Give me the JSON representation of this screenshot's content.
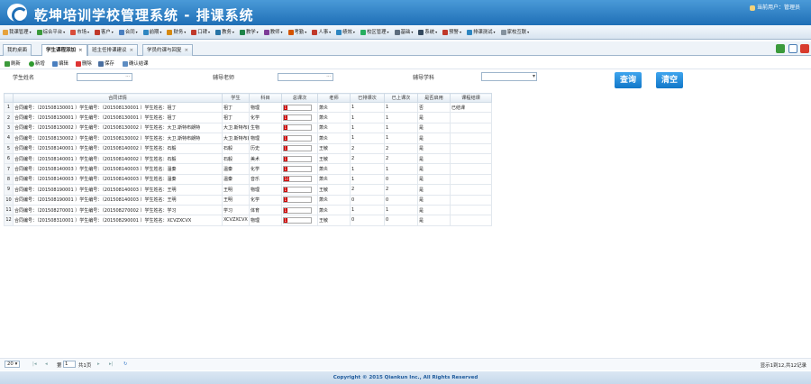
{
  "app": {
    "title": "乾坤培训学校管理系统 - 排课系统",
    "user": "当前用户：管理员"
  },
  "menu": [
    "我课管理",
    "综合平台",
    "市场",
    "客户",
    "合同",
    "前期",
    "财务",
    "口碑",
    "教务",
    "教学",
    "教师",
    "考勤",
    "人事",
    "绩效",
    "校区管理",
    "基础",
    "系统",
    "预警",
    "排课测试",
    "家校互联"
  ],
  "tabs": [
    "我的桌面",
    "学生课程添加",
    "班主任排课建议",
    "学员约课与回复"
  ],
  "toolbar": {
    "refresh": "刷新",
    "add": "新增",
    "edit": "编辑",
    "del": "删除",
    "save": "保存",
    "confirm": "确认结课"
  },
  "filters": {
    "student": "学生姓名",
    "teacher": "辅导老师",
    "subject": "辅导学科",
    "query": "查询",
    "clear": "清空",
    "dots": "···"
  },
  "table": {
    "headers": [
      "合同详情",
      "学生",
      "科目",
      "总课次",
      "老师",
      "已排课次",
      "已上课次",
      "是否启用",
      "课程结课"
    ],
    "rows": [
      [
        "1",
        "合同编号：（201508130001 ）学生编号：（201508130001 ）学生姓名：祖丁",
        "祖丁",
        "物理",
        "1",
        "萧炎",
        "1",
        "1",
        "否",
        "已结课"
      ],
      [
        "2",
        "合同编号：（201508130001 ）学生编号：（201508130001 ）学生姓名：祖丁",
        "祖丁",
        "化学",
        "1",
        "萧炎",
        "1",
        "1",
        "是",
        ""
      ],
      [
        "3",
        "合同编号：（201508130002 ）学生编号：（201508130002 ）学生姓名：大卫.斯特布朗特",
        "大卫.斯特布朗特",
        "生物",
        "1",
        "萧炎",
        "1",
        "1",
        "是",
        ""
      ],
      [
        "4",
        "合同编号：（201508130002 ）学生编号：（201508130002 ）学生姓名：大卫.斯特布朗特",
        "大卫.斯特布朗特",
        "物理",
        "1",
        "萧炎",
        "1",
        "1",
        "是",
        ""
      ],
      [
        "5",
        "合同编号：（201508140001 ）学生编号：（201508140002 ）学生姓名：石毅",
        "石毅",
        "历史",
        "1",
        "王敏",
        "2",
        "2",
        "是",
        ""
      ],
      [
        "6",
        "合同编号：（201508140001 ）学生编号：（201508140002 ）学生姓名：石毅",
        "石毅",
        "美术",
        "1",
        "王敏",
        "2",
        "2",
        "是",
        ""
      ],
      [
        "7",
        "合同编号：（201508140003 ）学生编号：（201508140003 ）学生姓名：温秦",
        "温秦",
        "化学",
        "1",
        "萧炎",
        "1",
        "1",
        "是",
        ""
      ],
      [
        "8",
        "合同编号：（201508140003 ）学生编号：（201508140003 ）学生姓名：温秦",
        "温秦",
        "音乐",
        "10",
        "萧炎",
        "1",
        "0",
        "是",
        ""
      ],
      [
        "9",
        "合同编号：（201508190001 ）学生编号：（201508140003 ）学生姓名：王明",
        "王明",
        "物理",
        "1",
        "王敏",
        "2",
        "2",
        "是",
        ""
      ],
      [
        "10",
        "合同编号：（201508190001 ）学生编号：（201508140003 ）学生姓名：王明",
        "王明",
        "化学",
        "1",
        "萧炎",
        "0",
        "0",
        "是",
        ""
      ],
      [
        "11",
        "合同编号：（201508270001 ）学生编号：（201508270002 ）学生姓名：学习",
        "学习",
        "体育",
        "1",
        "萧炎",
        "1",
        "1",
        "是",
        ""
      ],
      [
        "12",
        "合同编号：（201508310001 ）学生编号：（201508290001 ）学生姓名：XCVZXCVX",
        "XCVZXCVX",
        "物理",
        "1",
        "王敏",
        "0",
        "0",
        "是",
        ""
      ]
    ]
  },
  "pager": {
    "size": "20",
    "page_label": "第",
    "page": "1",
    "of": "共1页",
    "summary": "显示1到12,共12记录"
  },
  "footer": "Copyright © 2015 Qiankun Inc., All Rights Reserved"
}
